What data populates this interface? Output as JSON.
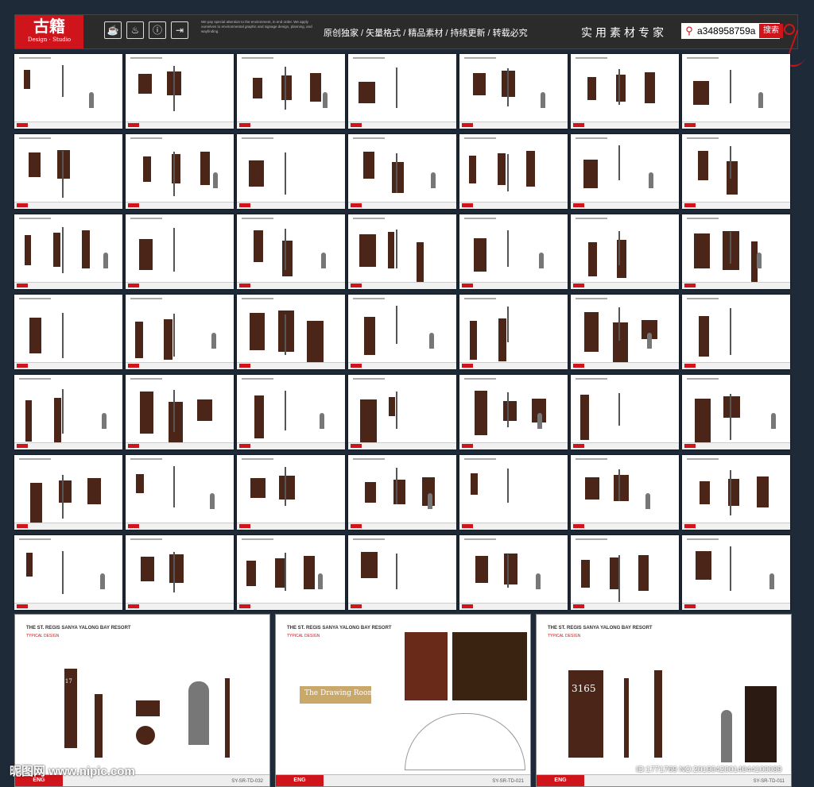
{
  "brand": {
    "logo_text": "古籍",
    "logo_sub": "Design · Studio"
  },
  "header": {
    "tagline": "We pay special attention to the environment, in end order. We apply ourselves to environmental graphic and signage design, planning, and wayfinding.",
    "slogan": "原创独家 / 矢量格式 / 精品素材 / 持续更新 / 转载必究",
    "expert": "实用素材专家",
    "icons": [
      "cup-icon",
      "coffee-icon",
      "info-icon",
      "exit-icon"
    ]
  },
  "search": {
    "value": "a348958759a",
    "button": "搜索"
  },
  "big_sheets": [
    {
      "title": "THE ST. REGIS SANYA YALONG BAY RESORT",
      "subtitle": "TYPICAL DESIGN",
      "room": "2117",
      "eng": "ENG CONSULTANCY",
      "code": "SY-SR-TD-032"
    },
    {
      "title": "THE ST. REGIS SANYA YALONG BAY RESORT",
      "subtitle": "TYPICAL DESIGN",
      "room": "The Drawing Room",
      "eng": "ENG CONSULTANCY",
      "code": "SY-SR-TD-021"
    },
    {
      "title": "THE ST. REGIS SANYA YALONG BAY RESORT",
      "subtitle": "TYPICAL DESIGN",
      "room": "3165",
      "eng": "ENG CONSULTANCY",
      "code": "SY-SR-TD-011"
    }
  ],
  "watermark": {
    "left": "昵图网 www.nipic.com",
    "right": "ID:1771769 NO:20190420014044100089"
  },
  "colors": {
    "accent": "#d0141c",
    "background": "#1f2a38",
    "sign_brown": "#4a2518"
  }
}
